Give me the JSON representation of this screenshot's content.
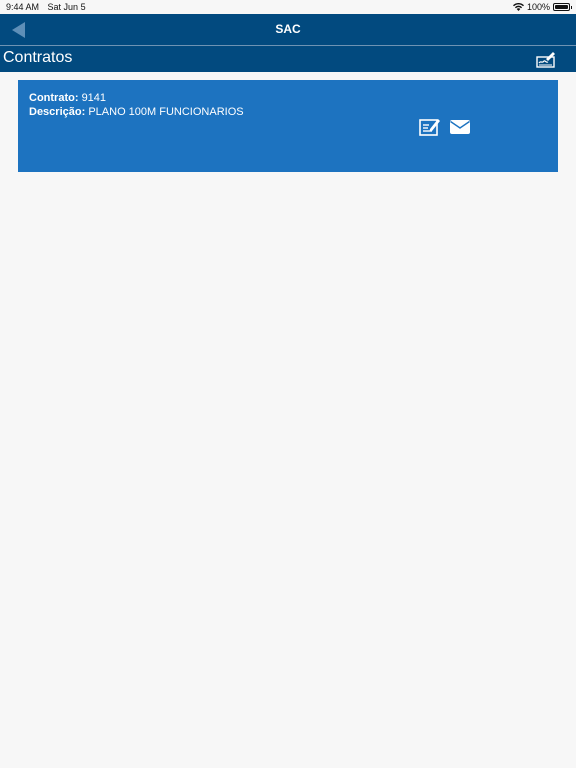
{
  "status_bar": {
    "time": "9:44 AM",
    "date": "Sat Jun 5",
    "battery": "100%"
  },
  "navbar": {
    "title": "SAC",
    "back_icon": "back-triangle-icon"
  },
  "section": {
    "title": "Contratos",
    "action_icon": "signature-icon"
  },
  "contracts": [
    {
      "contract_label": "Contrato:",
      "contract_value": "9141",
      "description_label": "Descrição:",
      "description_value": "PLANO 100M FUNCIONARIOS",
      "actions": [
        "edit-document-icon",
        "envelope-icon"
      ]
    }
  ],
  "colors": {
    "navbar": "#024a7f",
    "card": "#1d73c0",
    "background": "#f7f7f7"
  }
}
